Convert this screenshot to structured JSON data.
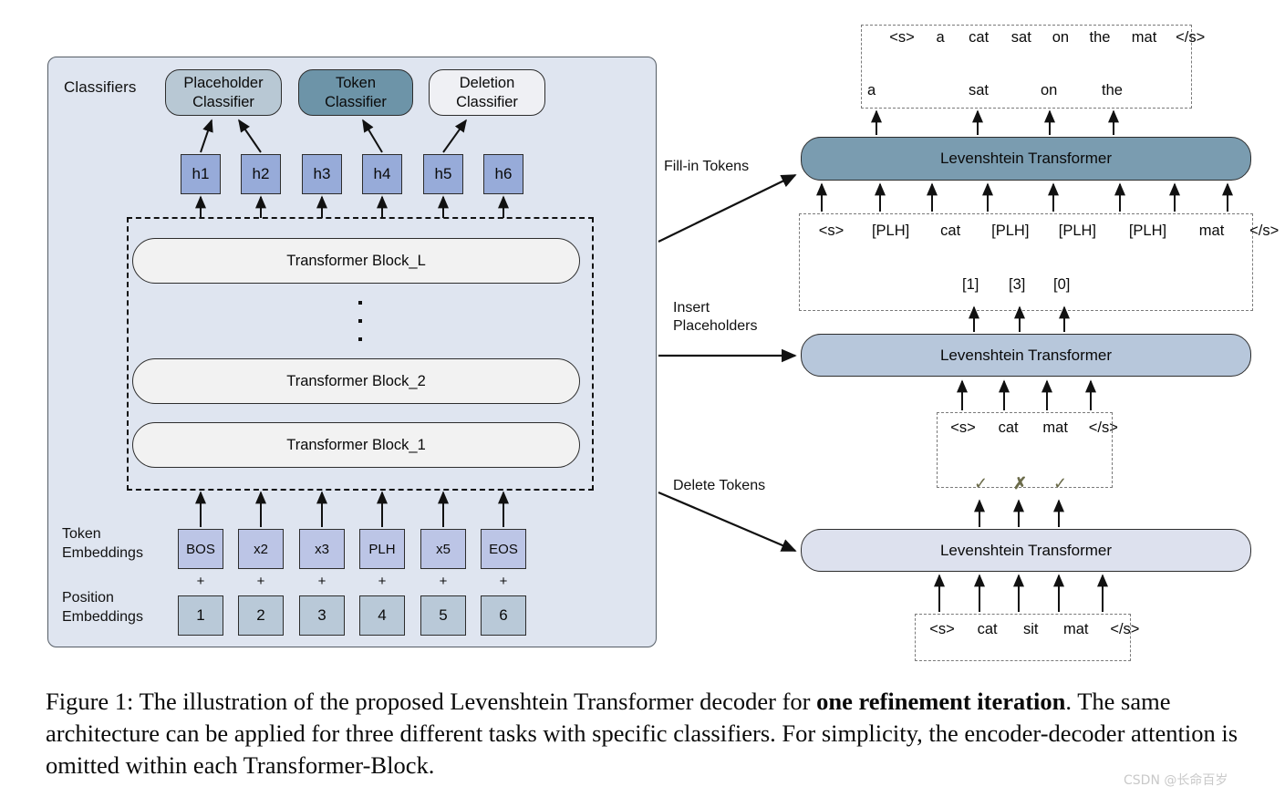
{
  "figure": {
    "caption_prefix": "Figure 1:",
    "caption_part1": " The illustration of the proposed Levenshtein Transformer decoder for ",
    "caption_bold1": "one refinement iteration",
    "caption_part2": ". The same architecture can be applied for three different tasks with specific classifiers. For simplicity, the encoder-decoder attention is omitted within each Transformer-Block.",
    "watermark": "CSDN @长命百岁"
  },
  "left_panel": {
    "classifiers_label": "Classifiers",
    "classifiers": [
      {
        "line1": "Placeholder",
        "line2": "Classifier",
        "color": "#b8c8d4"
      },
      {
        "line1": "Token",
        "line2": "Classifier",
        "color": "#6d94a8"
      },
      {
        "line1": "Deletion",
        "line2": "Classifier",
        "color": "#eff0f4"
      }
    ],
    "hidden_states": [
      "h1",
      "h2",
      "h3",
      "h4",
      "h5",
      "h6"
    ],
    "transformer_blocks": [
      {
        "label": "Transformer Block_L"
      },
      {
        "label": "Transformer Block_2"
      },
      {
        "label": "Transformer Block_1"
      }
    ],
    "vertical_dots": "⋮",
    "token_embeddings_label_line1": "Token",
    "token_embeddings_label_line2": "Embeddings",
    "position_embeddings_label_line1": "Position",
    "position_embeddings_label_line2": "Embeddings",
    "token_embeddings": [
      "BOS",
      "x2",
      "x3",
      "PLH",
      "x5",
      "EOS"
    ],
    "plus_signs": [
      "+",
      "+",
      "+",
      "+",
      "+",
      "+"
    ],
    "position_embeddings": [
      "1",
      "2",
      "3",
      "4",
      "5",
      "6"
    ]
  },
  "right_panel": {
    "stages": [
      {
        "name": "fill-in-tokens",
        "arrow_label": "Fill-in Tokens",
        "model_label": "Levenshtein Transformer",
        "model_color": "#7a9cb0",
        "output_sequence": [
          "<s>",
          "a",
          "cat",
          "sat",
          "on",
          "the",
          "mat",
          "</s>"
        ],
        "predicted_tokens": [
          "a",
          "sat",
          "on",
          "the"
        ],
        "input_sequence": [
          "<s>",
          "[PLH]",
          "cat",
          "[PLH]",
          "[PLH]",
          "[PLH]",
          "mat",
          "</s>"
        ]
      },
      {
        "name": "insert-placeholders",
        "arrow_label_line1": "Insert",
        "arrow_label_line2": "Placeholders",
        "model_label": "Levenshtein Transformer",
        "model_color": "#b7c7db",
        "placeholder_counts": [
          "[1]",
          "[3]",
          "[0]"
        ],
        "input_sequence": [
          "<s>",
          "cat",
          "mat",
          "</s>"
        ]
      },
      {
        "name": "delete-tokens",
        "arrow_label": "Delete Tokens",
        "model_label": "Levenshtein Transformer",
        "model_color": "#dde1ee",
        "deletion_decisions": [
          "✓",
          "✗",
          "✓"
        ],
        "input_sequence": [
          "<s>",
          "cat",
          "sit",
          "mat",
          "</s>"
        ]
      }
    ]
  }
}
